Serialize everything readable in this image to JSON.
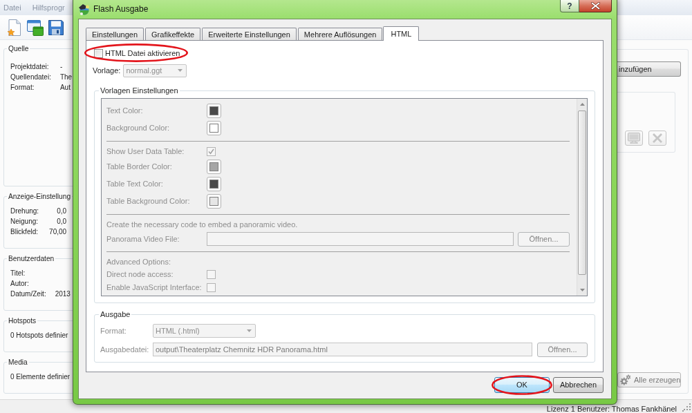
{
  "app": {
    "menu": [
      {
        "label": "Datei"
      },
      {
        "label": "Hilfsprogr"
      }
    ],
    "panels": [
      {
        "title": "Quelle",
        "kind": "fields",
        "rows": [
          {
            "label": "Projektdatei:",
            "value": "-"
          },
          {
            "label": "Quellendatei:",
            "value": "The"
          },
          {
            "label": "Format:",
            "value": "Aut"
          }
        ]
      },
      {
        "title": "Anzeige-Einstellung",
        "kind": "numbers",
        "rows": [
          {
            "label": "Drehung:",
            "value": "0,0"
          },
          {
            "label": "Neigung:",
            "value": "0,0"
          },
          {
            "label": "Blickfeld:",
            "value": "70,00"
          }
        ]
      },
      {
        "title": "Benutzerdaten",
        "kind": "fields",
        "rows": [
          {
            "label": "Titel:"
          },
          {
            "label": "Autor:"
          },
          {
            "label": "Datum/Zeit:",
            "value": "2013"
          }
        ]
      },
      {
        "title": "Hotspots",
        "kind": "text",
        "text": "0 Hotspots definier"
      },
      {
        "title": "Media",
        "kind": "text",
        "text": "0 Elemente definier"
      }
    ],
    "right_panel": {
      "add_button": {
        "label": "inzufügen",
        "disabled": false
      },
      "tool_buttons": [
        {
          "kind": "monitor",
          "disabled": true
        },
        {
          "kind": "delete",
          "disabled": true
        }
      ],
      "generate_button": {
        "label": "Alle erzeugen",
        "disabled": true
      }
    },
    "status_bar": {
      "text": "Lizenz 1 Benutzer: Thomas Fankhänel"
    }
  },
  "dialog": {
    "title": "Flash Ausgabe",
    "help_button": "?",
    "tabs": [
      {
        "label": "Einstellungen",
        "selected": false
      },
      {
        "label": "Grafikeffekte",
        "selected": false
      },
      {
        "label": "Erweiterte Einstellungen",
        "selected": false
      },
      {
        "label": "Mehrere Auflösungen",
        "selected": false
      },
      {
        "label": "HTML",
        "selected": true
      }
    ],
    "enable_html": {
      "label": "HTML Datei aktivieren",
      "checked": false,
      "circled": true
    },
    "template": {
      "label": "Vorlage:",
      "value": "normal.ggt",
      "disabled": true
    },
    "template_settings": {
      "title": "Vorlagen Einstellungen",
      "disabled": true,
      "items": [
        {
          "kind": "color",
          "label": "Text Color:",
          "color": "#4a4a4a"
        },
        {
          "kind": "color",
          "label": "Background Color:",
          "color": "#ffffff"
        },
        {
          "kind": "separator"
        },
        {
          "kind": "checkbox",
          "label": "Show User Data Table:",
          "checked": true
        },
        {
          "kind": "color",
          "label": "Table Border Color:",
          "color": "#a6a6a6"
        },
        {
          "kind": "color",
          "label": "Table Text Color:",
          "color": "#4a4a4a"
        },
        {
          "kind": "color",
          "label": "Table Background Color:",
          "color": "#e6e6e6"
        },
        {
          "kind": "separator"
        },
        {
          "kind": "note",
          "label": "Create the necessary code to embed a panoramic video."
        },
        {
          "kind": "file",
          "label": "Panorama Video File:",
          "button": "Öffnen..."
        },
        {
          "kind": "separator"
        },
        {
          "kind": "note",
          "label": "Advanced Options:"
        },
        {
          "kind": "checkbox",
          "label": "Direct node access:",
          "checked": false
        },
        {
          "kind": "checkbox",
          "label": "Enable JavaScript Interface:",
          "checked": false
        }
      ]
    },
    "output": {
      "title": "Ausgabe",
      "disabled": true,
      "format": {
        "label": "Format:",
        "value": "HTML (.html)"
      },
      "file": {
        "label": "Ausgabedatei:",
        "value": "output\\Theaterplatz Chemnitz HDR Panorama.html",
        "button": "Öffnen..."
      }
    },
    "buttons": [
      {
        "label": "OK",
        "default": true,
        "circled": true
      },
      {
        "label": "Abbrechen",
        "default": false,
        "circled": false
      }
    ]
  }
}
